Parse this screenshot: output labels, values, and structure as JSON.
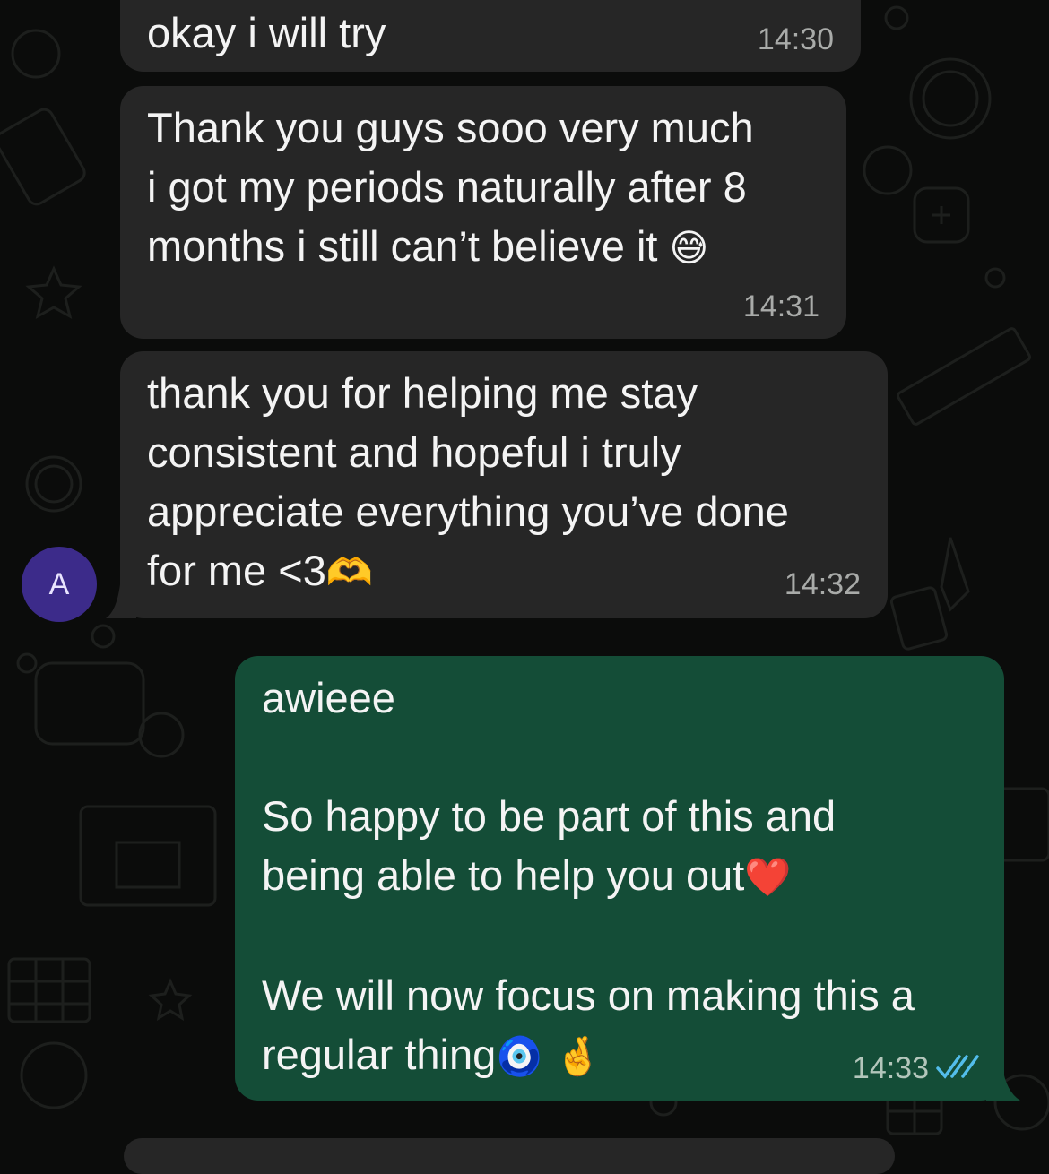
{
  "chat": {
    "contact_avatar_letter": "A",
    "colors": {
      "incoming_bubble": "#262626",
      "outgoing_bubble": "#144d37",
      "avatar": "#3c2b8a",
      "read_ticks": "#53bdeb"
    },
    "messages": [
      {
        "text": "okay i will try",
        "time": "14:30",
        "direction": "incoming"
      },
      {
        "text": "Thank you guys sooo very much\ni got my periods naturally after 8\nmonths i still can’t believe it",
        "emoji": "😅",
        "time": "14:31",
        "direction": "incoming"
      },
      {
        "text": "thank you for helping me stay\nconsistent and hopeful i truly\nappreciate everything you’ve done\nfor me <3",
        "emoji": "🫶",
        "time": "14:32",
        "direction": "incoming"
      },
      {
        "text": "awieee\n\nSo happy to be part of this and\nbeing able to help you out",
        "emoji": "❤️",
        "text2": "\n\nWe will now focus on making this a\nregular thing",
        "emoji2": "🧿 🤞",
        "time": "14:33",
        "direction": "outgoing",
        "status": "read-double-check-icon"
      }
    ]
  }
}
